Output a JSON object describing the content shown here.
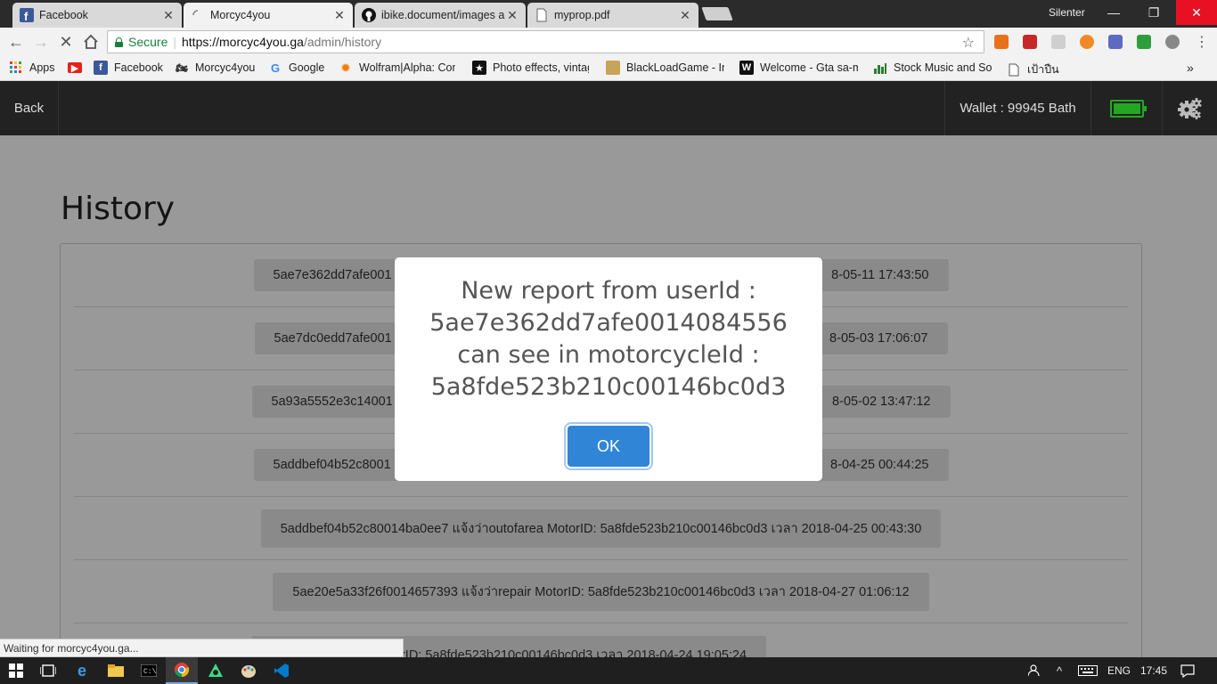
{
  "browser": {
    "tabs": [
      {
        "label": "Facebook",
        "icon": "facebook-icon",
        "active": false
      },
      {
        "label": "Morcyc4you",
        "icon": "loading-spinner-icon",
        "active": true
      },
      {
        "label": "ibike.document/images a",
        "icon": "github-icon",
        "active": false
      },
      {
        "label": "myprop.pdf",
        "icon": "document-icon",
        "active": false
      }
    ],
    "profile_name": "Silenter",
    "omnibox": {
      "secure_label": "Secure",
      "url_scheme_host": "https://morcyc4you.ga",
      "url_path": "/admin/history"
    },
    "bookmarks": [
      {
        "label": "Apps",
        "icon": "apps-grid-icon"
      },
      {
        "label": "",
        "icon": "youtube-icon"
      },
      {
        "label": "Facebook",
        "icon": "facebook-icon"
      },
      {
        "label": "Morcyc4you",
        "icon": "motorcycle-icon"
      },
      {
        "label": "Google",
        "icon": "google-icon"
      },
      {
        "label": "Wolfram|Alpha: Com",
        "icon": "wolfram-icon"
      },
      {
        "label": "Photo effects, vintag",
        "icon": "star-icon"
      },
      {
        "label": "BlackLoadGame - Inc",
        "icon": "game-icon"
      },
      {
        "label": "Welcome - Gta sa-m",
        "icon": "w-icon"
      },
      {
        "label": "Stock Music and Sou",
        "icon": "audio-bars-icon"
      },
      {
        "label": "เป้าปืน",
        "icon": "page-icon"
      }
    ],
    "status_text": "Waiting for morcyc4you.ga..."
  },
  "appbar": {
    "back_label": "Back",
    "wallet_label": "Wallet : 99945 Bath",
    "battery_level": 1.0,
    "accent_color": "#22a822"
  },
  "history": {
    "title": "History",
    "rows": [
      {
        "text": "5ae7e362dd7afe001"
      },
      {
        "text": "5ae7dc0edd7afe001"
      },
      {
        "text": "5a93a5552e3c14001"
      },
      {
        "text": "5addbef04b52c8001"
      },
      {
        "text": "5addbef04b52c80014ba0ee7 แจ้งว่าoutofarea MotorID: 5a8fde523b210c00146bc0d3 เวลา 2018-04-25 00:43:30"
      },
      {
        "text": "5ae20e5a33f26f0014657393 แจ้งว่าrepair MotorID: 5a8fde523b210c00146bc0d3 เวลา 2018-04-27 01:06:12"
      },
      {
        "text": "ba0ee7 แจ้งว่าrepair MotorID: 5a8fde523b210c00146bc0d3 เวลา 2018-04-24 19:05:24"
      }
    ],
    "row_tails": [
      "8-05-11 17:43:50",
      "8-05-03 17:06:07",
      "8-05-02 13:47:12",
      "8-04-25 00:44:25"
    ]
  },
  "dialog": {
    "message_lines": [
      "New report from userId :",
      "5ae7e362dd7afe0014084556",
      "can see in motorcycleId :",
      "5a8fde523b210c00146bc0d3"
    ],
    "ok_label": "OK",
    "ok_color": "#3085d6"
  },
  "taskbar": {
    "language": "ENG",
    "time": "17:45"
  }
}
